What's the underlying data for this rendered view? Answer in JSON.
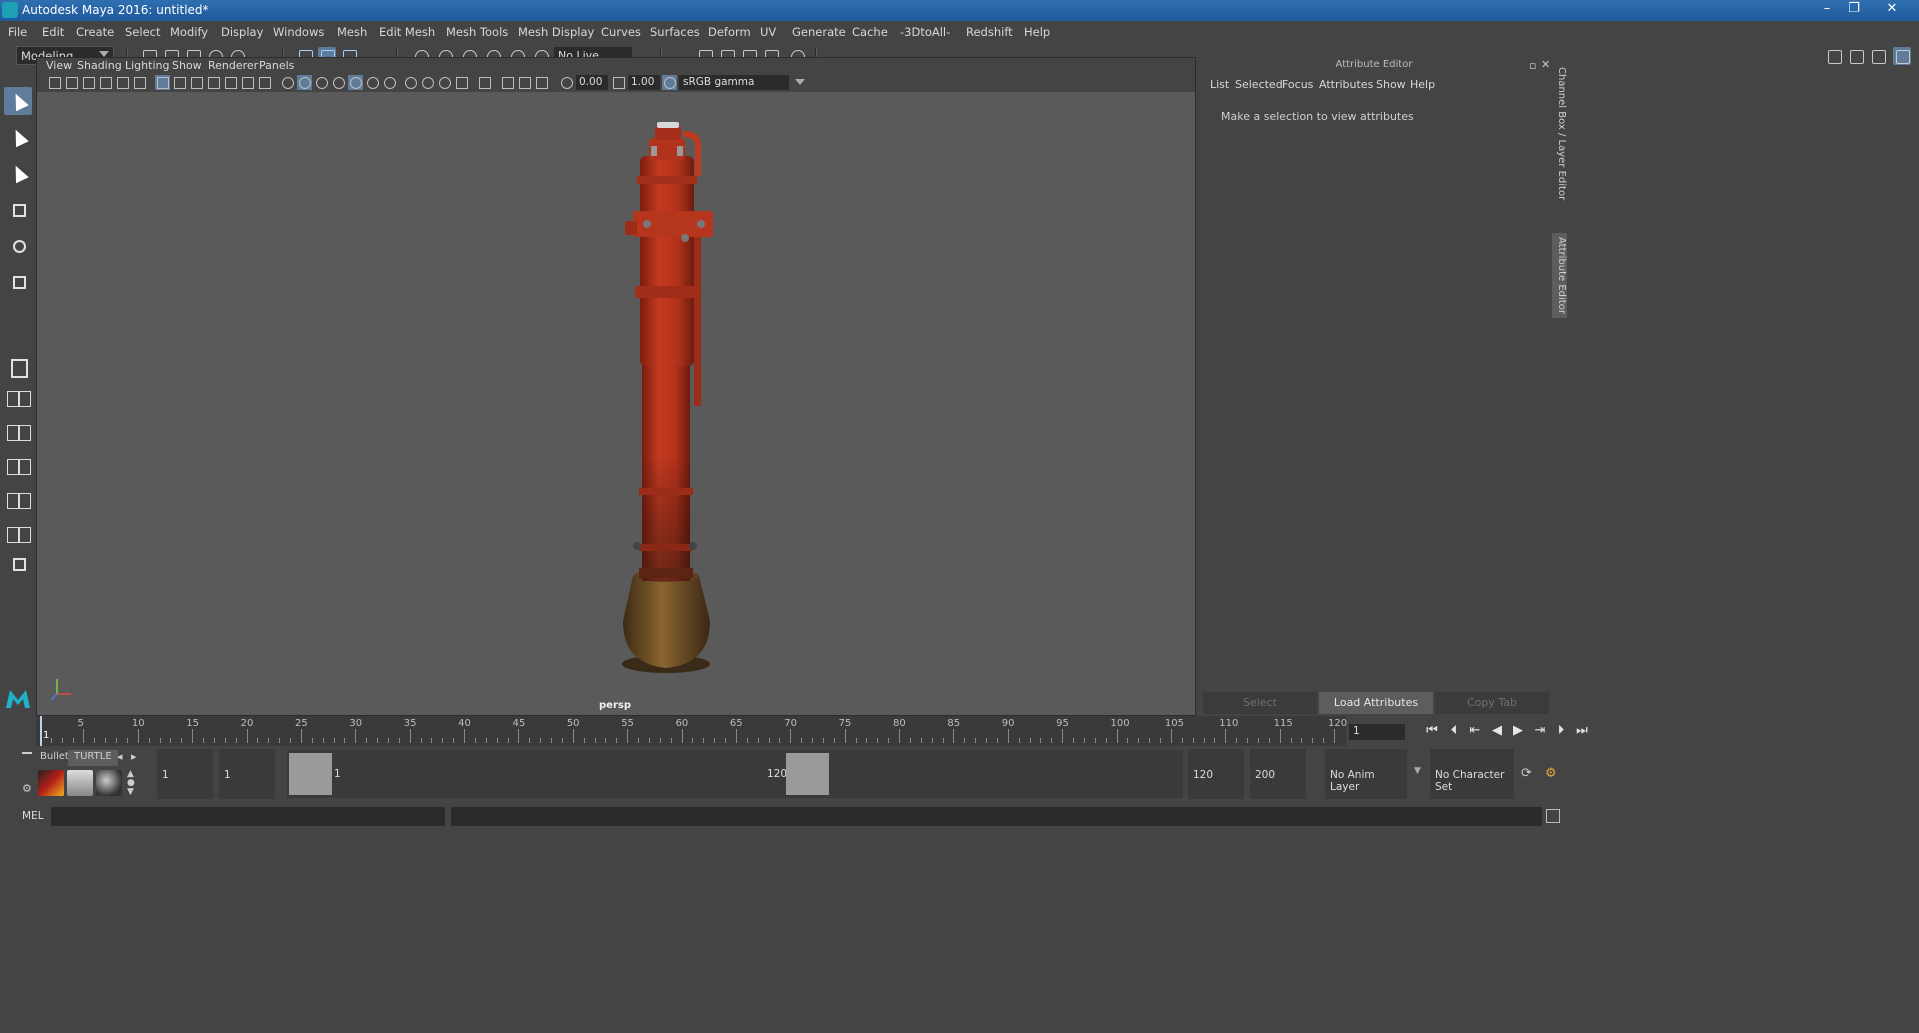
{
  "window": {
    "title": "Autodesk Maya 2016: untitled*",
    "controls": [
      "–",
      "❐",
      "✕"
    ]
  },
  "menubar": {
    "items": [
      "File",
      "Edit",
      "Create",
      "Select",
      "Modify",
      "Display",
      "Windows",
      "Mesh",
      "Edit Mesh",
      "Mesh Tools",
      "Mesh Display",
      "Curves",
      "Surfaces",
      "Deform",
      "UV",
      "Generate",
      "Cache",
      "-3DtoAll-",
      "Redshift",
      "Help"
    ]
  },
  "statusline": {
    "mode": "Modeling",
    "live_surface": "No Live Surface"
  },
  "viewport": {
    "menus": [
      "View",
      "Shading",
      "Lighting",
      "Show",
      "Renderer",
      "Panels"
    ],
    "exposure": "0.00",
    "gamma_value": "1.00",
    "color_space": "sRGB gamma",
    "camera_label": "persp",
    "object_colors": {
      "paint": "#b3321c",
      "rust": "#6b4a22"
    }
  },
  "attribute_editor": {
    "title": "Attribute Editor",
    "menus": [
      "List",
      "Selected",
      "Focus",
      "Attributes",
      "Show",
      "Help"
    ],
    "message": "Make a selection to view attributes",
    "buttons": {
      "select": "Select",
      "load": "Load Attributes",
      "copy": "Copy Tab"
    }
  },
  "side_tabs": {
    "channel_box": "Channel Box / Layer Editor",
    "attribute_editor": "Attribute Editor"
  },
  "timeslider": {
    "ticks": [
      1,
      5,
      10,
      15,
      20,
      25,
      30,
      35,
      40,
      45,
      50,
      55,
      60,
      65,
      70,
      75,
      80,
      85,
      90,
      95,
      100,
      105,
      110,
      115,
      120
    ],
    "current_frame": "1",
    "current_marker": "1"
  },
  "shelf": {
    "tabs": [
      "Bullet",
      "TURTLE"
    ]
  },
  "range": {
    "start": "1",
    "playback_start": "1",
    "range_start_label": "1",
    "range_end_label": "120",
    "playback_end": "120",
    "end": "200",
    "anim_layer": "No Anim Layer",
    "character_set": "No Character Set"
  },
  "cmdline": {
    "language": "MEL"
  },
  "colors": {
    "accent": "#5f7d9a",
    "panel": "#444444",
    "viewport": "#5a5a5a"
  }
}
